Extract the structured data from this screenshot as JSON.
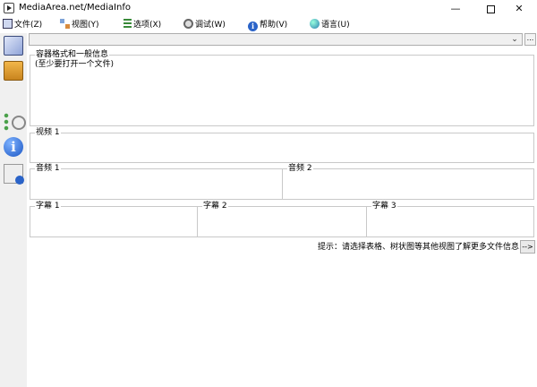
{
  "window": {
    "title": "MediaArea.net/MediaInfo",
    "minimize_glyph": "—",
    "close_glyph": "✕"
  },
  "menu": {
    "items": [
      {
        "label": "文件(Z)",
        "icon": "document-icon"
      },
      {
        "label": "视图(Y)",
        "icon": "view-icon"
      },
      {
        "label": "选项(X)",
        "icon": "options-icon"
      },
      {
        "label": "调试(W)",
        "icon": "debug-gear-icon"
      },
      {
        "label": "帮助(V)",
        "icon": "help-info-icon"
      },
      {
        "label": "语言(U)",
        "icon": "language-globe-icon"
      }
    ]
  },
  "file_selector": {
    "value": "",
    "arrow": "⌄",
    "more_label": "..."
  },
  "panels": {
    "general": {
      "title": "容器格式和一般信息",
      "subtitle": "(至少要打开一个文件)"
    },
    "video": {
      "title": "视频 1"
    },
    "audio1": {
      "title": "音频 1"
    },
    "audio2": {
      "title": "音频 2"
    },
    "sub1": {
      "title": "字幕 1"
    },
    "sub2": {
      "title": "字幕 2"
    },
    "sub3": {
      "title": "字幕 3"
    }
  },
  "footer": {
    "hint": "提示：请选择表格、树状图等其他视图了解更多文件信息",
    "next_label": "-->"
  },
  "colors": {
    "info_blue": "#2a63c8",
    "panel_border": "#c9c9c9",
    "sidebar_bg": "#f0f0f0"
  }
}
